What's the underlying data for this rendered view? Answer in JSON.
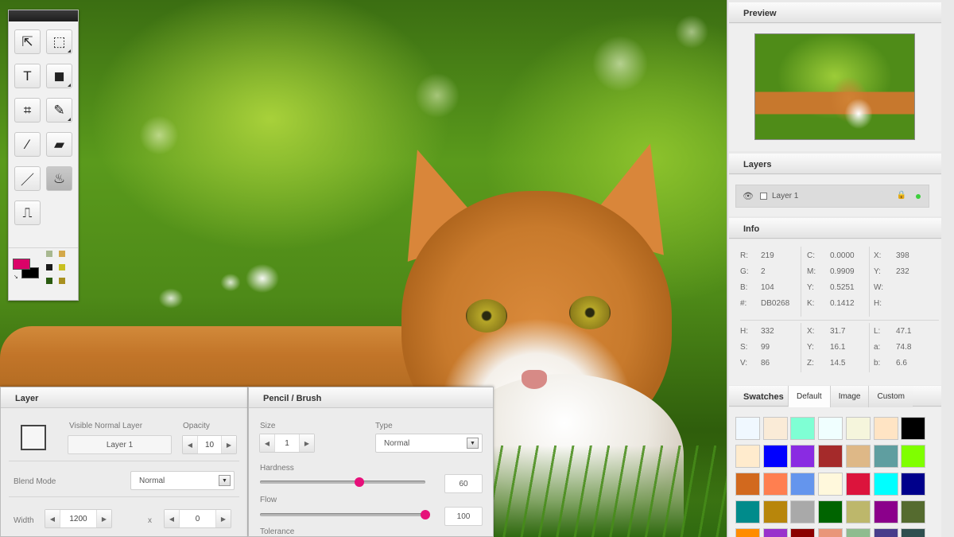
{
  "tools": {
    "items": [
      {
        "name": "move-tool",
        "glyph": "⇱",
        "corner": false
      },
      {
        "name": "marquee-tool",
        "glyph": "⬚",
        "corner": true
      },
      {
        "name": "text-tool",
        "glyph": "T",
        "corner": false
      },
      {
        "name": "shape-tool",
        "glyph": "◼",
        "corner": true
      },
      {
        "name": "crop-tool",
        "glyph": "⌗",
        "corner": false
      },
      {
        "name": "brush-tool",
        "glyph": "✎",
        "corner": true
      },
      {
        "name": "eyedropper-tool",
        "glyph": "⁄",
        "corner": false
      },
      {
        "name": "eraser-tool",
        "glyph": "▰",
        "corner": false
      },
      {
        "name": "pencil-tool",
        "glyph": "／",
        "corner": false
      },
      {
        "name": "bucket-tool",
        "glyph": "♨",
        "corner": false
      },
      {
        "name": "stamp-tool",
        "glyph": "⎍",
        "corner": false
      }
    ],
    "foreground": "#DB0268",
    "background": "#000000",
    "mini_swatches": [
      "#a8b890",
      "#d4a84a",
      "#1a1a1a",
      "#c8c020",
      "#2a5a10",
      "#a89020"
    ]
  },
  "preview": {
    "title": "Preview"
  },
  "layers": {
    "title": "Layers",
    "row_label": "Layer 1"
  },
  "info": {
    "title": "Info",
    "rgb": [
      [
        "R:",
        "219"
      ],
      [
        "G:",
        "2"
      ],
      [
        "B:",
        "104"
      ],
      [
        "#:",
        "DB0268"
      ]
    ],
    "cmyk": [
      [
        "C:",
        "0.0000"
      ],
      [
        "M:",
        "0.9909"
      ],
      [
        "Y:",
        "0.5251"
      ],
      [
        "K:",
        "0.1412"
      ]
    ],
    "pos": [
      [
        "X:",
        "398"
      ],
      [
        "Y:",
        "232"
      ],
      [
        "W:",
        ""
      ],
      [
        "H:",
        ""
      ]
    ],
    "hsv": [
      [
        "H:",
        "332"
      ],
      [
        "S:",
        "99"
      ],
      [
        "V:",
        "86"
      ]
    ],
    "xyz": [
      [
        "X:",
        "31.7"
      ],
      [
        "Y:",
        "16.1"
      ],
      [
        "Z:",
        "14.5"
      ]
    ],
    "lab": [
      [
        "L:",
        "47.1"
      ],
      [
        "a:",
        "74.8"
      ],
      [
        "b:",
        "6.6"
      ]
    ]
  },
  "swatches": {
    "title": "Swatches",
    "tabs": [
      "Default",
      "Image",
      "Custom"
    ],
    "colors": [
      "#f0f8ff",
      "#faebd7",
      "#7fffd4",
      "#f0ffff",
      "#f5f5dc",
      "#ffe4c4",
      "#000000",
      "#ffebcd",
      "#0000ff",
      "#8a2be2",
      "#a52a2a",
      "#deb887",
      "#5f9ea0",
      "#7fff00",
      "#d2691e",
      "#ff7f50",
      "#6495ed",
      "#fff8dc",
      "#dc143c",
      "#00ffff",
      "#00008b",
      "#008b8b",
      "#b8860b",
      "#a9a9a9",
      "#006400",
      "#bdb76b",
      "#8b008b",
      "#556b2f",
      "#ff8c00",
      "#9932cc",
      "#8b0000",
      "#e9967a",
      "#8fbc8f",
      "#483d8b",
      "#2f4f4f"
    ]
  },
  "layer_panel": {
    "title": "Layer",
    "subtitle": "Visible Normal Layer",
    "name_value": "Layer 1",
    "opacity_label": "Opacity",
    "opacity_value": "10",
    "blend_label": "Blend Mode",
    "blend_value": "Normal",
    "width_label": "Width",
    "width_value": "1200",
    "x_label": "x",
    "height_value": "0"
  },
  "brush_panel": {
    "title": "Pencil / Brush",
    "size_label": "Size",
    "size_value": "1",
    "type_label": "Type",
    "type_value": "Normal",
    "hardness_label": "Hardness",
    "hardness_value": "60",
    "hardness_level": 0.6,
    "flow_label": "Flow",
    "flow_value": "100",
    "flow_level": 1.0,
    "tolerance_label": "Tolerance"
  }
}
